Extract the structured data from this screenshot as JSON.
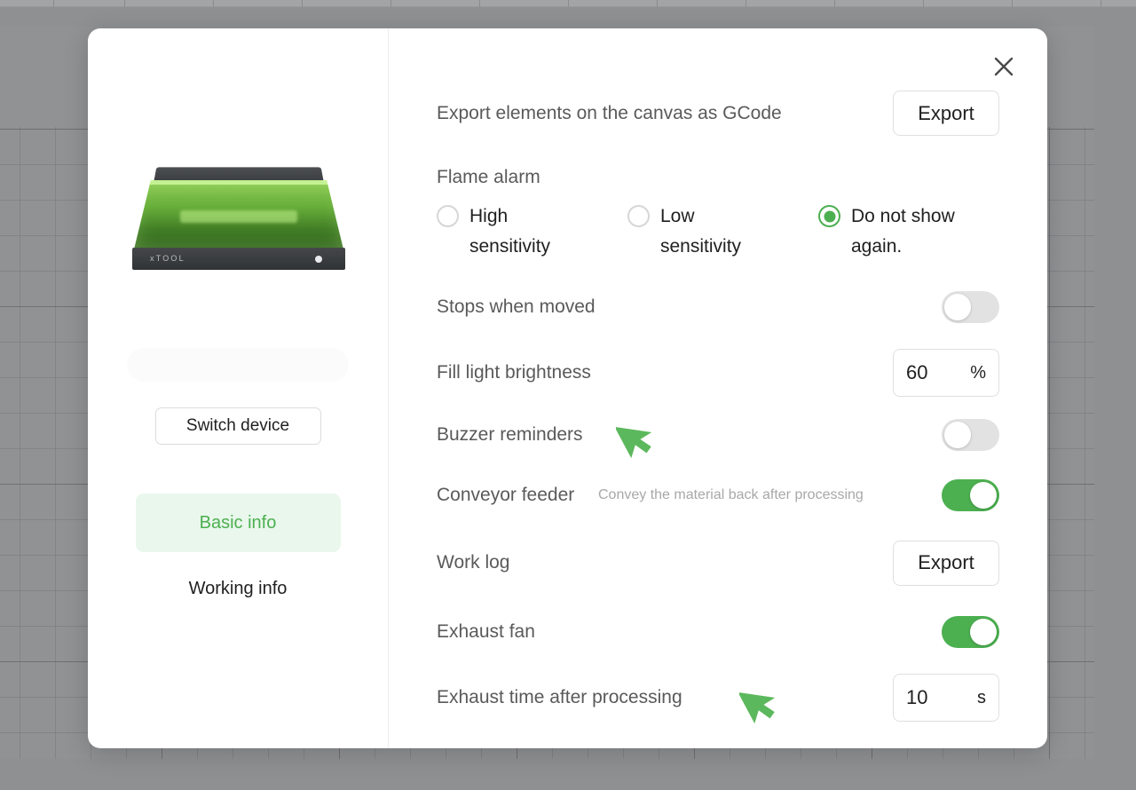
{
  "app": {
    "background": "#8f9092",
    "accent_green": "#4caf50"
  },
  "modal": {
    "close_icon": "close-icon",
    "sidebar": {
      "device_image_alt": "xtool-laser-device",
      "device_brand": "xTOOL",
      "device_name_placeholder": "",
      "switch_device_label": "Switch device",
      "nav_items": [
        {
          "label": "Basic info",
          "active": true
        },
        {
          "label": "Working info",
          "active": false
        }
      ]
    },
    "settings": {
      "export_gcode": {
        "label": "Export elements on the canvas as GCode",
        "button_label": "Export"
      },
      "flame_alarm": {
        "title": "Flame alarm",
        "options": [
          {
            "label": "High sensitivity",
            "selected": false
          },
          {
            "label": "Low sensitivity",
            "selected": false
          },
          {
            "label": "Do not show again.",
            "selected": true
          }
        ]
      },
      "stops_when_moved": {
        "label": "Stops when moved",
        "toggle_state": "off"
      },
      "fill_light_brightness": {
        "label": "Fill light brightness",
        "value": "60",
        "unit": "%"
      },
      "buzzer_reminders": {
        "label": "Buzzer reminders",
        "toggle_state": "off"
      },
      "conveyor_feeder": {
        "label": "Conveyor feeder",
        "description": "Convey the material back after processing",
        "toggle_state": "on"
      },
      "work_log": {
        "label": "Work log",
        "button_label": "Export"
      },
      "exhaust_fan": {
        "label": "Exhaust fan",
        "toggle_state": "on"
      },
      "exhaust_time": {
        "label": "Exhaust time after processing",
        "value": "10",
        "unit": "s"
      }
    }
  },
  "cursors": [
    {
      "name": "cursor-buzzer",
      "color": "#5cb85c"
    },
    {
      "name": "cursor-exhaust-time",
      "color": "#5cb85c"
    }
  ]
}
